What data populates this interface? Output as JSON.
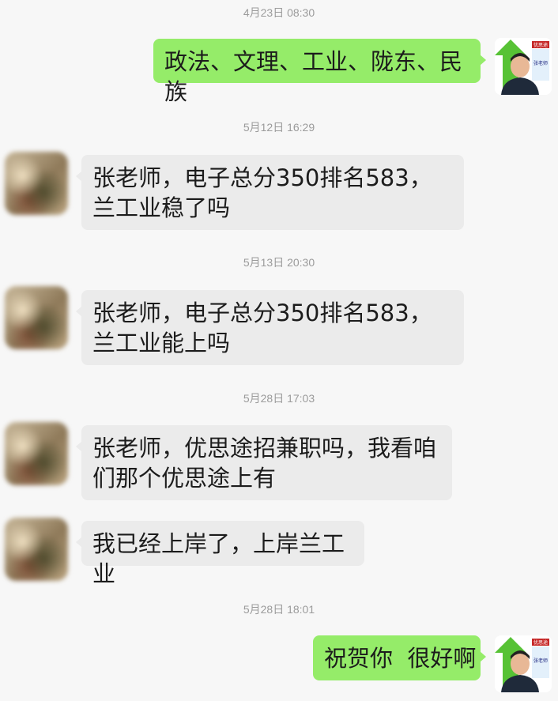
{
  "messages": [
    {
      "kind": "time",
      "text": "4月23日 08:30"
    },
    {
      "kind": "sent",
      "text": "政法、文理、工业、陇东、民族"
    },
    {
      "kind": "time",
      "text": "5月12日 16:29"
    },
    {
      "kind": "received",
      "text": "张老师，电子总分350排名583，兰工业稳了吗"
    },
    {
      "kind": "time",
      "text": "5月13日 20:30"
    },
    {
      "kind": "received",
      "text": "张老师，电子总分350排名583，兰工业能上吗"
    },
    {
      "kind": "time",
      "text": "5月28日 17:03"
    },
    {
      "kind": "received",
      "text": "张老师，优思途招兼职吗，我看咱们那个优思途上有"
    },
    {
      "kind": "received",
      "text": "我已经上岸了，上岸兰工业"
    },
    {
      "kind": "time",
      "text": "5月28日 18:01"
    },
    {
      "kind": "sent",
      "text": "祝贺你  很好啊"
    }
  ],
  "self_avatar": {
    "badge": "优思途",
    "side_text": "张老师"
  },
  "colors": {
    "sent_bubble": "#95ec69",
    "received_bubble": "#ebebeb",
    "background": "#f7f7f7"
  }
}
